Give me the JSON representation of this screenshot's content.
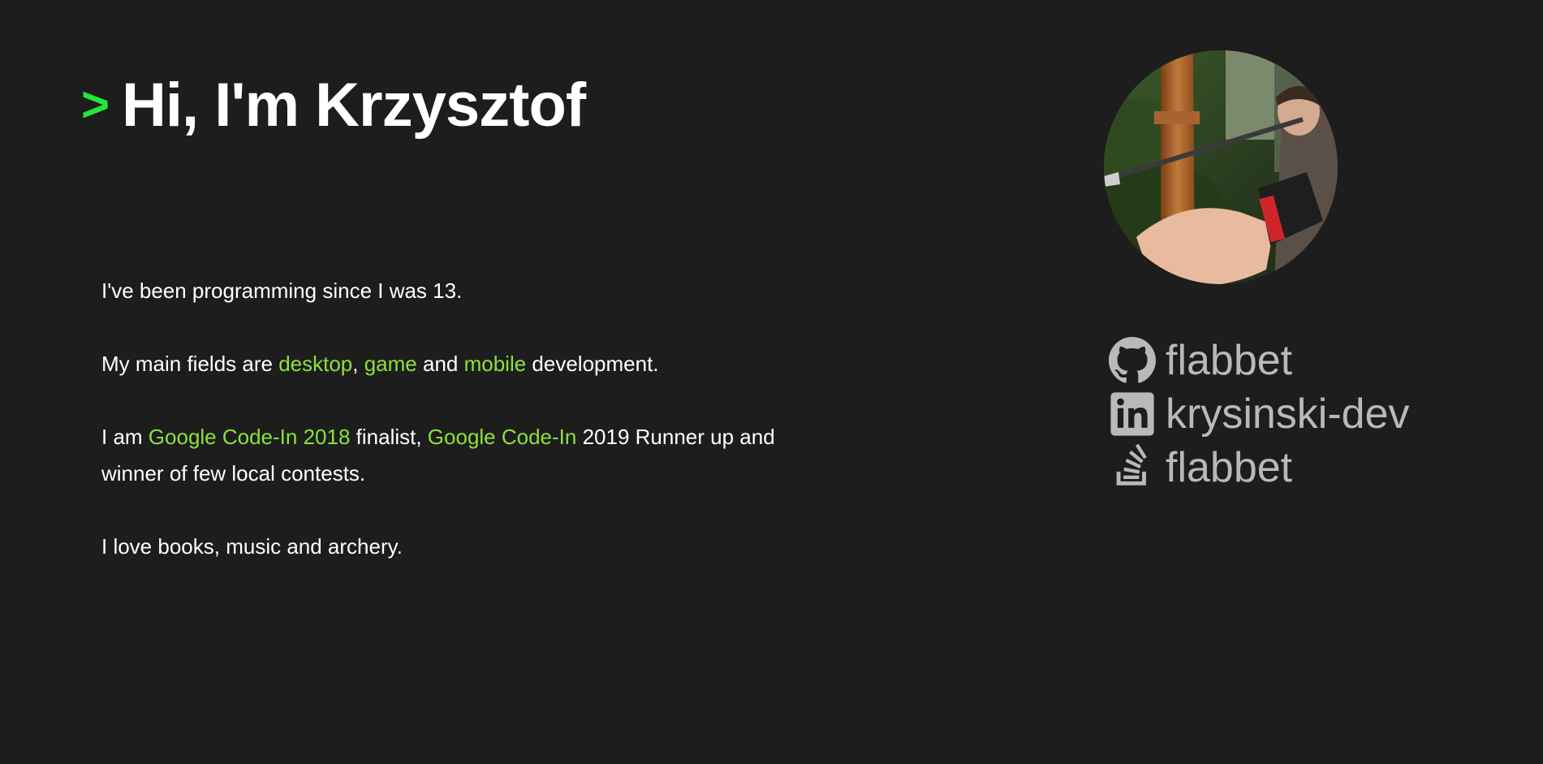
{
  "header": {
    "prompt": ">",
    "title": "Hi, I'm Krzysztof"
  },
  "bio": {
    "line1": "I've been programming since I was 13.",
    "fields": {
      "prefix": "My main fields are ",
      "desktop": "desktop",
      "comma": ", ",
      "game": "game",
      "and": " and ",
      "mobile": "mobile",
      "suffix": " development."
    },
    "contests": {
      "prefix": "I am ",
      "gci2018": "Google Code-In 2018",
      "mid": " finalist, ",
      "gci": "Google Code-In",
      "suffix": " 2019 Runner up and winner of few local contests."
    },
    "hobbies": "I love books, music and archery."
  },
  "socials": [
    {
      "icon": "github-icon",
      "label": "flabbet"
    },
    {
      "icon": "linkedin-icon",
      "label": "krysinski-dev"
    },
    {
      "icon": "stackoverflow-icon",
      "label": "flabbet"
    }
  ],
  "colors": {
    "background": "#1d1d1d",
    "prompt": "#22e63a",
    "highlight": "#8ce13a",
    "social": "#b9b9b9"
  }
}
